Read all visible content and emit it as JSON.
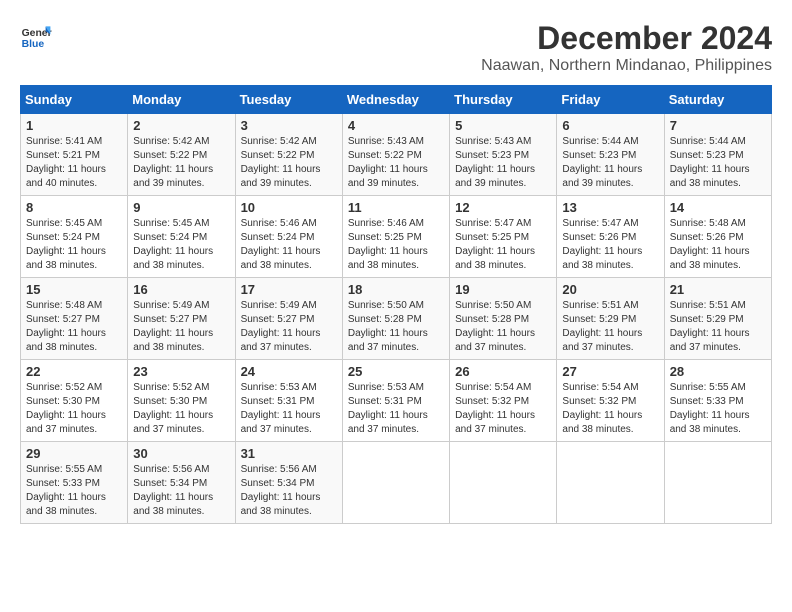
{
  "header": {
    "logo_text_general": "General",
    "logo_text_blue": "Blue",
    "main_title": "December 2024",
    "subtitle": "Naawan, Northern Mindanao, Philippines"
  },
  "calendar": {
    "days_of_week": [
      "Sunday",
      "Monday",
      "Tuesday",
      "Wednesday",
      "Thursday",
      "Friday",
      "Saturday"
    ],
    "weeks": [
      [
        null,
        {
          "day": "2",
          "sunrise": "Sunrise: 5:42 AM",
          "sunset": "Sunset: 5:22 PM",
          "daylight": "Daylight: 11 hours and 39 minutes."
        },
        {
          "day": "3",
          "sunrise": "Sunrise: 5:42 AM",
          "sunset": "Sunset: 5:22 PM",
          "daylight": "Daylight: 11 hours and 39 minutes."
        },
        {
          "day": "4",
          "sunrise": "Sunrise: 5:43 AM",
          "sunset": "Sunset: 5:22 PM",
          "daylight": "Daylight: 11 hours and 39 minutes."
        },
        {
          "day": "5",
          "sunrise": "Sunrise: 5:43 AM",
          "sunset": "Sunset: 5:23 PM",
          "daylight": "Daylight: 11 hours and 39 minutes."
        },
        {
          "day": "6",
          "sunrise": "Sunrise: 5:44 AM",
          "sunset": "Sunset: 5:23 PM",
          "daylight": "Daylight: 11 hours and 39 minutes."
        },
        {
          "day": "7",
          "sunrise": "Sunrise: 5:44 AM",
          "sunset": "Sunset: 5:23 PM",
          "daylight": "Daylight: 11 hours and 38 minutes."
        }
      ],
      [
        {
          "day": "1",
          "sunrise": "Sunrise: 5:41 AM",
          "sunset": "Sunset: 5:21 PM",
          "daylight": "Daylight: 11 hours and 40 minutes."
        },
        {
          "day": "9",
          "sunrise": "Sunrise: 5:45 AM",
          "sunset": "Sunset: 5:24 PM",
          "daylight": "Daylight: 11 hours and 38 minutes."
        },
        {
          "day": "10",
          "sunrise": "Sunrise: 5:46 AM",
          "sunset": "Sunset: 5:24 PM",
          "daylight": "Daylight: 11 hours and 38 minutes."
        },
        {
          "day": "11",
          "sunrise": "Sunrise: 5:46 AM",
          "sunset": "Sunset: 5:25 PM",
          "daylight": "Daylight: 11 hours and 38 minutes."
        },
        {
          "day": "12",
          "sunrise": "Sunrise: 5:47 AM",
          "sunset": "Sunset: 5:25 PM",
          "daylight": "Daylight: 11 hours and 38 minutes."
        },
        {
          "day": "13",
          "sunrise": "Sunrise: 5:47 AM",
          "sunset": "Sunset: 5:26 PM",
          "daylight": "Daylight: 11 hours and 38 minutes."
        },
        {
          "day": "14",
          "sunrise": "Sunrise: 5:48 AM",
          "sunset": "Sunset: 5:26 PM",
          "daylight": "Daylight: 11 hours and 38 minutes."
        }
      ],
      [
        {
          "day": "8",
          "sunrise": "Sunrise: 5:45 AM",
          "sunset": "Sunset: 5:24 PM",
          "daylight": "Daylight: 11 hours and 38 minutes."
        },
        {
          "day": "16",
          "sunrise": "Sunrise: 5:49 AM",
          "sunset": "Sunset: 5:27 PM",
          "daylight": "Daylight: 11 hours and 38 minutes."
        },
        {
          "day": "17",
          "sunrise": "Sunrise: 5:49 AM",
          "sunset": "Sunset: 5:27 PM",
          "daylight": "Daylight: 11 hours and 37 minutes."
        },
        {
          "day": "18",
          "sunrise": "Sunrise: 5:50 AM",
          "sunset": "Sunset: 5:28 PM",
          "daylight": "Daylight: 11 hours and 37 minutes."
        },
        {
          "day": "19",
          "sunrise": "Sunrise: 5:50 AM",
          "sunset": "Sunset: 5:28 PM",
          "daylight": "Daylight: 11 hours and 37 minutes."
        },
        {
          "day": "20",
          "sunrise": "Sunrise: 5:51 AM",
          "sunset": "Sunset: 5:29 PM",
          "daylight": "Daylight: 11 hours and 37 minutes."
        },
        {
          "day": "21",
          "sunrise": "Sunrise: 5:51 AM",
          "sunset": "Sunset: 5:29 PM",
          "daylight": "Daylight: 11 hours and 37 minutes."
        }
      ],
      [
        {
          "day": "15",
          "sunrise": "Sunrise: 5:48 AM",
          "sunset": "Sunset: 5:27 PM",
          "daylight": "Daylight: 11 hours and 38 minutes."
        },
        {
          "day": "23",
          "sunrise": "Sunrise: 5:52 AM",
          "sunset": "Sunset: 5:30 PM",
          "daylight": "Daylight: 11 hours and 37 minutes."
        },
        {
          "day": "24",
          "sunrise": "Sunrise: 5:53 AM",
          "sunset": "Sunset: 5:31 PM",
          "daylight": "Daylight: 11 hours and 37 minutes."
        },
        {
          "day": "25",
          "sunrise": "Sunrise: 5:53 AM",
          "sunset": "Sunset: 5:31 PM",
          "daylight": "Daylight: 11 hours and 37 minutes."
        },
        {
          "day": "26",
          "sunrise": "Sunrise: 5:54 AM",
          "sunset": "Sunset: 5:32 PM",
          "daylight": "Daylight: 11 hours and 37 minutes."
        },
        {
          "day": "27",
          "sunrise": "Sunrise: 5:54 AM",
          "sunset": "Sunset: 5:32 PM",
          "daylight": "Daylight: 11 hours and 38 minutes."
        },
        {
          "day": "28",
          "sunrise": "Sunrise: 5:55 AM",
          "sunset": "Sunset: 5:33 PM",
          "daylight": "Daylight: 11 hours and 38 minutes."
        }
      ],
      [
        {
          "day": "22",
          "sunrise": "Sunrise: 5:52 AM",
          "sunset": "Sunset: 5:30 PM",
          "daylight": "Daylight: 11 hours and 37 minutes."
        },
        {
          "day": "30",
          "sunrise": "Sunrise: 5:56 AM",
          "sunset": "Sunset: 5:34 PM",
          "daylight": "Daylight: 11 hours and 38 minutes."
        },
        {
          "day": "31",
          "sunrise": "Sunrise: 5:56 AM",
          "sunset": "Sunset: 5:34 PM",
          "daylight": "Daylight: 11 hours and 38 minutes."
        },
        null,
        null,
        null,
        null
      ],
      [
        {
          "day": "29",
          "sunrise": "Sunrise: 5:55 AM",
          "sunset": "Sunset: 5:33 PM",
          "daylight": "Daylight: 11 hours and 38 minutes."
        },
        null,
        null,
        null,
        null,
        null,
        null
      ]
    ]
  }
}
